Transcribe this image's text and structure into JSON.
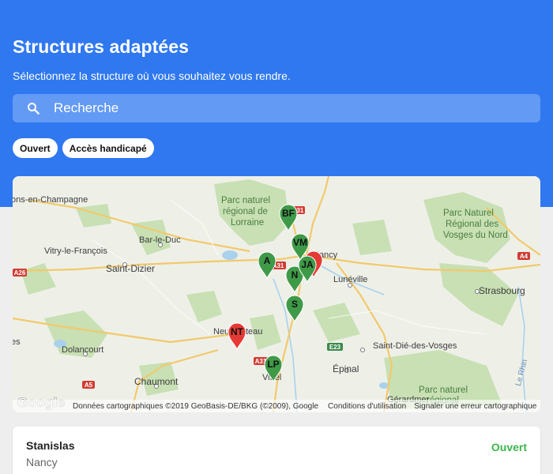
{
  "header": {
    "title": "Structures adaptées",
    "subtitle": "Sélectionnez la structure où vous souhaitez vous rendre."
  },
  "search": {
    "placeholder": "Recherche",
    "icon": "search-icon"
  },
  "filters": [
    {
      "label": "Ouvert"
    },
    {
      "label": "Accès handicapé"
    }
  ],
  "map": {
    "labels": [
      "ons-en-Champagne",
      "Parc naturel",
      "régional de",
      "Lorraine",
      "Bar-le-Duc",
      "Vitry-le-François",
      "Saint-Dizier",
      "Parc Naturel",
      "Régional des",
      "Vosges du Nord",
      "Lunéville",
      "Strasbourg",
      "Dolancourt",
      "Neufchâteau",
      "Saint-Dié-des-Vosges",
      "Épinal",
      "Chaumont",
      "Vittel",
      "Parc naturel",
      "régional",
      "Gérardmer",
      "Le Rhin",
      "Nancy",
      "es"
    ],
    "roads": [
      "A31",
      "A26",
      "A4",
      "A31",
      "E23",
      "A31",
      "A5"
    ],
    "markers": [
      {
        "label": "BF",
        "color": "#3f9a48"
      },
      {
        "label": "VM",
        "color": "#3f9a48"
      },
      {
        "label": "",
        "color": "#e53935"
      },
      {
        "label": "A",
        "color": "#3f9a48"
      },
      {
        "label": "N",
        "color": "#3f9a48"
      },
      {
        "label": "JA",
        "color": "#3f9a48"
      },
      {
        "label": "S",
        "color": "#3f9a48"
      },
      {
        "label": "NT",
        "color": "#e53935"
      },
      {
        "label": "LP",
        "color": "#3f9a48"
      }
    ],
    "attribution": {
      "data": "Données cartographiques ©2019 GeoBasis-DE/BKG (©2009), Google",
      "terms": "Conditions d'utilisation",
      "report": "Signaler une erreur cartographique",
      "logo": "Google"
    }
  },
  "results": [
    {
      "name": "Stanislas",
      "city": "Nancy",
      "status": "Ouvert"
    }
  ],
  "colors": {
    "header_bg": "#2f78f0",
    "open_green": "#3cb54a",
    "marker_green": "#3f9a48",
    "marker_red": "#e53935"
  }
}
